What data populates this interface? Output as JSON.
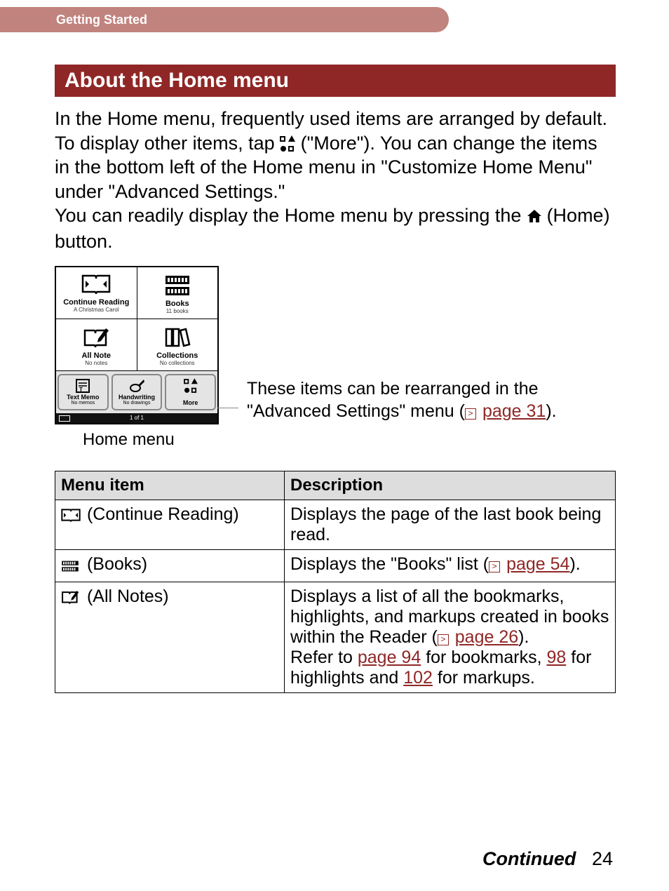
{
  "header": {
    "breadcrumb": "Getting Started"
  },
  "title": "About the Home menu",
  "intro": {
    "p1a": "In the Home menu, frequently used items are arranged by default. To display other items, tap ",
    "p1b": " (\"More\"). You can change the items in the bottom left of the Home menu in \"Customize Home Menu\" under \"Advanced Settings.\"",
    "p2a": "You can readily display the Home menu by pressing the ",
    "p2b": " (Home) button."
  },
  "device": {
    "continue_reading": {
      "label": "Continue Reading",
      "sub": "A Christmas Carol"
    },
    "books": {
      "label": "Books",
      "sub": "11 books"
    },
    "all_note": {
      "label": "All Note",
      "sub": "No notes"
    },
    "collections": {
      "label": "Collections",
      "sub": "No collections"
    },
    "text_memo": {
      "label": "Text Memo",
      "sub": "No memos"
    },
    "handwriting": {
      "label": "Handwriting",
      "sub": "No drawings"
    },
    "more": {
      "label": "More"
    },
    "status": "1 of 1"
  },
  "callout": {
    "text_a": "These items can be rearranged in the \"Advanced Settings\" menu (",
    "link": "page 31",
    "text_b": ")."
  },
  "caption": "Home menu",
  "table": {
    "headers": {
      "menu_item": "Menu item",
      "description": "Description"
    },
    "rows": {
      "r1": {
        "label": " (Continue Reading)",
        "desc": "Displays the page of the last book being read."
      },
      "r2": {
        "label": " (Books)",
        "desc_a": "Displays the \"Books\" list (",
        "link": "page 54",
        "desc_b": ")."
      },
      "r3": {
        "label": "  (All Notes)",
        "desc_a": "Displays a list of all the bookmarks, highlights, and markups created in books within the Reader (",
        "link1": "page 26",
        "desc_b": ").",
        "desc_c": "Refer to ",
        "link2": "page 94",
        "desc_d": " for bookmarks, ",
        "link3": "98",
        "desc_e": " for highlights and ",
        "link4": "102",
        "desc_f": " for markups."
      }
    }
  },
  "footer": {
    "continued": "Continued",
    "page": "24"
  }
}
